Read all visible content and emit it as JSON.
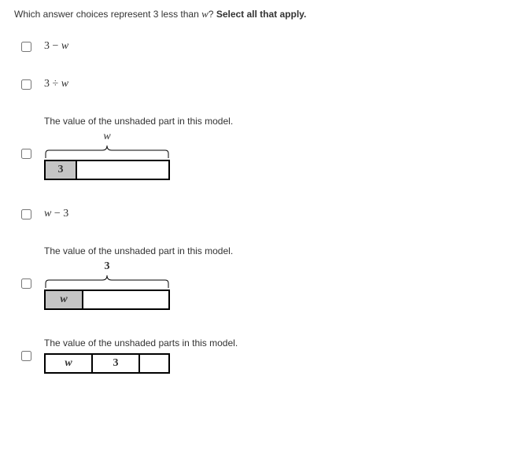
{
  "question": {
    "prefix": "Which answer choices represent 3 less than ",
    "var": "w",
    "suffix": "? ",
    "bold": "Select all that apply."
  },
  "choices": {
    "a": {
      "expr_html": "3 − <span class='var'>w</span>"
    },
    "b": {
      "expr_html": "3 ÷ <span class='var'>w</span>"
    },
    "c": {
      "desc": "The value of the unshaded part in this model.",
      "brace_label": "w",
      "cell1": "3",
      "cell1_width": 40,
      "total_width": 160
    },
    "d": {
      "expr_html": "<span class='var'>w</span> − 3"
    },
    "e": {
      "desc": "The value of the unshaded part in this model.",
      "brace_label": "3",
      "cell1": "w",
      "cell1_width": 48,
      "total_width": 160
    },
    "f": {
      "desc": "The value of the unshaded parts in this model.",
      "cell1": "w",
      "cell2": "3",
      "cell1_width": 60,
      "cell2_width": 60,
      "total_width": 160
    }
  }
}
